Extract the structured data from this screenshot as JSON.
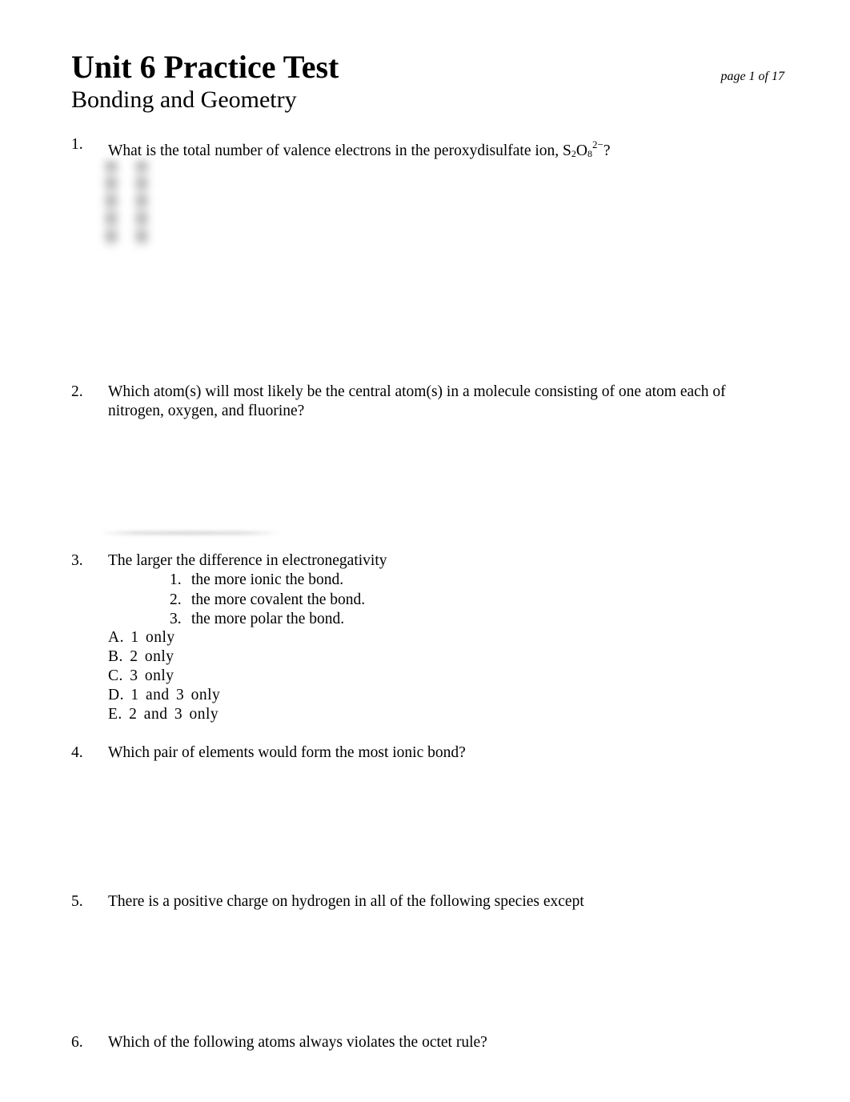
{
  "document": {
    "title": "Unit 6 Practice Test",
    "subtitle": "Bonding and Geometry",
    "page_indicator": "page 1 of 17"
  },
  "questions": [
    {
      "number": "1.",
      "text_before": "What is the total number of valence electrons in the peroxydisulfate ion, S",
      "sub1": "2",
      "mid": "O",
      "sub2": "8",
      "sup": "2−",
      "text_after": "?",
      "answer_choices_obscured": true
    },
    {
      "number": "2.",
      "text": "Which atom(s) will most likely be the central atom(s) in a molecule consisting of one atom each of nitrogen, oxygen, and fluorine?"
    },
    {
      "number": "3.",
      "text": "The larger the difference in electronegativity",
      "statements": [
        {
          "n": "1.",
          "text": "the more ionic the bond."
        },
        {
          "n": "2.",
          "text": "the more covalent the bond."
        },
        {
          "n": "3.",
          "text": "the more polar the bond."
        }
      ],
      "choices": [
        "A. 1 only",
        "B. 2 only",
        "C. 3 only",
        "D. 1 and 3 only",
        "E. 2 and 3 only"
      ]
    },
    {
      "number": "4.",
      "text": "Which pair of elements would form the most ionic bond?"
    },
    {
      "number": "5.",
      "text": "There is a positive charge on hydrogen in all of the following species except"
    },
    {
      "number": "6.",
      "text": "Which of the following atoms always violates the octet rule?"
    }
  ]
}
